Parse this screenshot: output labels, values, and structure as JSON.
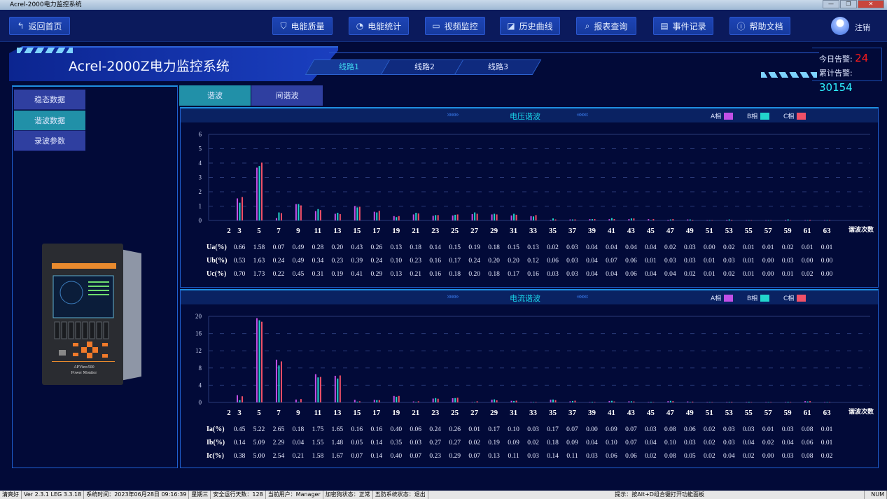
{
  "window": {
    "title": "Acrel-2000电力监控系统",
    "min": "—",
    "max": "❐",
    "close": "✕"
  },
  "header": {
    "back": "返回首页",
    "nav": [
      {
        "label": "电能质量",
        "icon": "shield-icon"
      },
      {
        "label": "电能统计",
        "icon": "pie-icon"
      },
      {
        "label": "视频监控",
        "icon": "video-icon"
      },
      {
        "label": "历史曲线",
        "icon": "chart-icon"
      },
      {
        "label": "报表查询",
        "icon": "search-icon"
      },
      {
        "label": "事件记录",
        "icon": "document-icon"
      },
      {
        "label": "帮助文档",
        "icon": "help-icon"
      }
    ],
    "logout": "注销"
  },
  "banner": {
    "title": "Acrel-2000Z电力监控系统",
    "lines": [
      "线路1",
      "线路2",
      "线路3"
    ],
    "active_line": 0,
    "alarm_today_label": "今日告警:",
    "alarm_today": "24",
    "alarm_total_label": "累计告警:",
    "alarm_total": "30154"
  },
  "sidebar": {
    "items": [
      "稳态数据",
      "谐波数据",
      "录波参数"
    ],
    "active": 1,
    "device_brand": "Acrel",
    "device_model": "APView500",
    "device_name": "Power Monitor"
  },
  "tabs": {
    "items": [
      "谐波",
      "间谐波"
    ],
    "active": 0
  },
  "colors": {
    "A": "#c24fe6",
    "B": "#22d6cc",
    "C": "#f05068"
  },
  "chart_data": [
    {
      "type": "bar",
      "title": "电压谐波",
      "legend": [
        "A相",
        "B相",
        "C相"
      ],
      "legend_position": "top-right",
      "xlabel": "谐波次数",
      "ylim": [
        0,
        6
      ],
      "yticks": [
        0,
        1,
        2,
        3,
        4,
        5,
        6
      ],
      "grid": true,
      "categories": [
        "2",
        "3",
        "5",
        "7",
        "9",
        "11",
        "13",
        "15",
        "17",
        "19",
        "21",
        "23",
        "25",
        "27",
        "29",
        "31",
        "33",
        "35",
        "37",
        "39",
        "41",
        "43",
        "45",
        "47",
        "49",
        "51",
        "53",
        "55",
        "57",
        "59",
        "61",
        "63"
      ],
      "series": [
        {
          "name": "Ua(%)",
          "values": [
            null,
            0.66,
            1.58,
            0.07,
            0.49,
            0.28,
            0.2,
            0.43,
            0.26,
            0.13,
            0.18,
            0.14,
            0.15,
            0.19,
            0.18,
            0.15,
            0.13,
            0.02,
            0.03,
            0.04,
            0.04,
            0.04,
            0.04,
            0.02,
            0.03,
            0.0,
            0.02,
            0.01,
            0.01,
            0.02,
            0.01,
            0.01
          ]
        },
        {
          "name": "Ub(%)",
          "values": [
            null,
            0.53,
            1.63,
            0.24,
            0.49,
            0.34,
            0.23,
            0.39,
            0.24,
            0.1,
            0.23,
            0.16,
            0.17,
            0.24,
            0.2,
            0.2,
            0.12,
            0.06,
            0.03,
            0.04,
            0.07,
            0.06,
            0.01,
            0.03,
            0.03,
            0.01,
            0.03,
            0.01,
            0.0,
            0.03,
            0.0,
            0.0
          ]
        },
        {
          "name": "Uc(%)",
          "values": [
            null,
            0.7,
            1.73,
            0.22,
            0.45,
            0.31,
            0.19,
            0.41,
            0.29,
            0.13,
            0.21,
            0.16,
            0.18,
            0.2,
            0.18,
            0.17,
            0.16,
            0.03,
            0.03,
            0.04,
            0.04,
            0.06,
            0.04,
            0.04,
            0.02,
            0.01,
            0.02,
            0.01,
            0.0,
            0.01,
            0.02,
            0.0
          ]
        }
      ]
    },
    {
      "type": "bar",
      "title": "电流谐波",
      "legend": [
        "A相",
        "B相",
        "C相"
      ],
      "legend_position": "top-right",
      "xlabel": "谐波次数",
      "ylim": [
        0,
        20
      ],
      "yticks": [
        0,
        4,
        8,
        12,
        16,
        20
      ],
      "grid": true,
      "categories": [
        "2",
        "3",
        "5",
        "7",
        "9",
        "11",
        "13",
        "15",
        "17",
        "19",
        "21",
        "23",
        "25",
        "27",
        "29",
        "31",
        "33",
        "35",
        "37",
        "39",
        "41",
        "43",
        "45",
        "47",
        "49",
        "51",
        "53",
        "55",
        "57",
        "59",
        "61",
        "63"
      ],
      "series": [
        {
          "name": "Ia(%)",
          "values": [
            null,
            0.45,
            5.22,
            2.65,
            0.18,
            1.75,
            1.65,
            0.16,
            0.16,
            0.4,
            0.06,
            0.24,
            0.26,
            0.01,
            0.17,
            0.1,
            0.03,
            0.17,
            0.07,
            0.0,
            0.09,
            0.07,
            0.03,
            0.08,
            0.06,
            0.02,
            0.03,
            0.03,
            0.01,
            0.03,
            0.08,
            0.01
          ]
        },
        {
          "name": "Ib(%)",
          "values": [
            null,
            0.14,
            5.09,
            2.29,
            0.04,
            1.55,
            1.48,
            0.05,
            0.14,
            0.35,
            0.03,
            0.27,
            0.27,
            0.02,
            0.19,
            0.09,
            0.02,
            0.18,
            0.09,
            0.04,
            0.1,
            0.07,
            0.04,
            0.1,
            0.03,
            0.02,
            0.03,
            0.04,
            0.02,
            0.04,
            0.06,
            0.01
          ]
        },
        {
          "name": "Ic(%)",
          "values": [
            null,
            0.38,
            5.0,
            2.54,
            0.21,
            1.58,
            1.67,
            0.07,
            0.14,
            0.4,
            0.07,
            0.23,
            0.29,
            0.07,
            0.13,
            0.11,
            0.03,
            0.14,
            0.11,
            0.03,
            0.06,
            0.06,
            0.02,
            0.08,
            0.05,
            0.02,
            0.04,
            0.02,
            0.0,
            0.03,
            0.08,
            0.02
          ]
        }
      ]
    }
  ],
  "statusbar": [
    "清爽好",
    "Ver 2.3.1 LEG 3.3.18",
    "系统时间：2023年06月28日  09:16:39",
    "星期三",
    "安全运行天数：128",
    "当前用户：Manager",
    "加密狗状态：正常",
    "五防系统状态：退出",
    "提示：按Alt+D组合键打开功能面板",
    "NUM"
  ]
}
